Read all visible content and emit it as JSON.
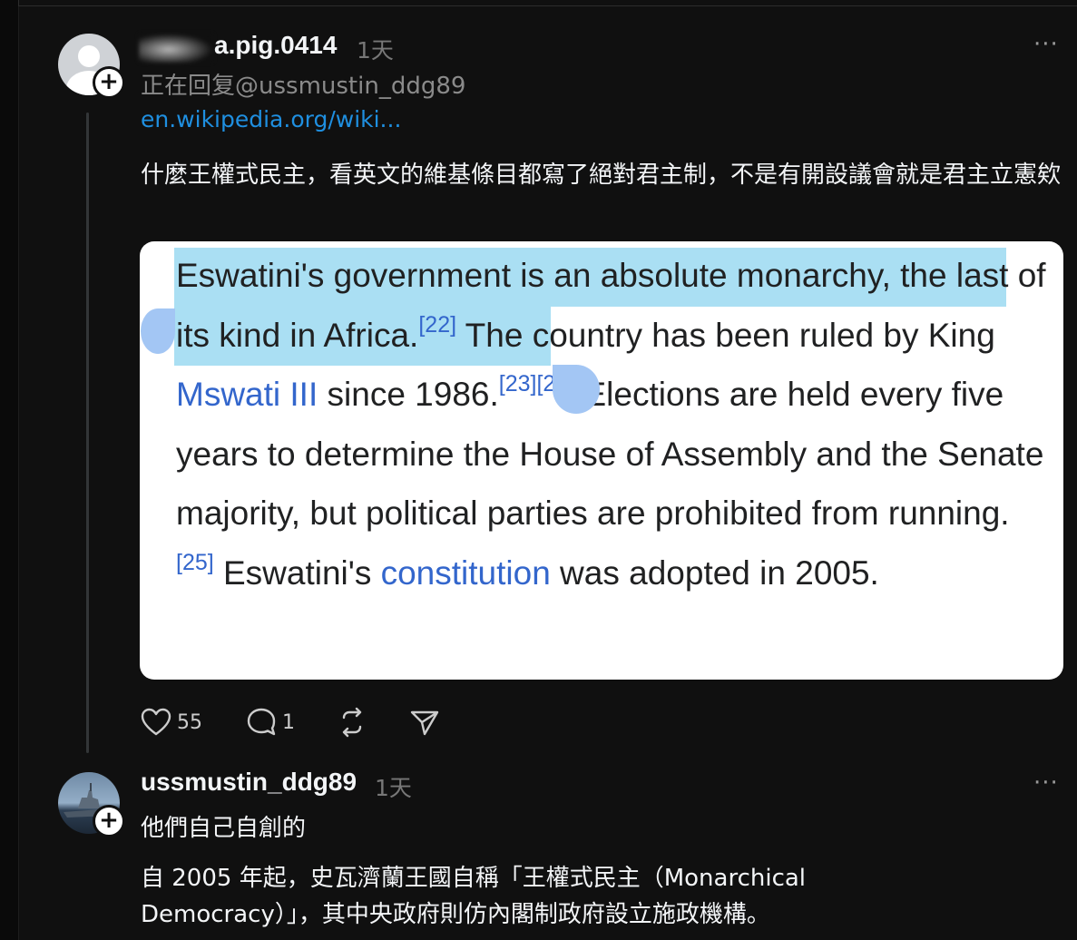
{
  "post": {
    "username": "a.pig.0414",
    "time": "1天",
    "replying_to": "正在回复@ussmustin_ddg89",
    "link": "en.wikipedia.org/wiki...",
    "text": "什麼王權式民主，看英文的維基條目都寫了絕對君主制，不是有開設議會就是君主立憲欸",
    "screenshot": {
      "s1": "Eswatini's government is an absolute monarchy, the last of its kind in Africa.",
      "ref22": "[22]",
      "s2": " The country has been ruled by King ",
      "mswati": "Mswati III",
      "s3": " since 1986.",
      "ref2324": "[23][24]",
      "s4": " Elections are held every five years to determine the House of Assembly and the Senate majority, but political parties are prohibited from running.",
      "ref25": "[25]",
      "s5": " Eswatini's ",
      "constitution": "constitution",
      "s6": " was adopted in 2005."
    },
    "likes": "55",
    "replies": "1"
  },
  "reply": {
    "username": "ussmustin_ddg89",
    "time": "1天",
    "text": "他們自己自創的",
    "body": "自 2005 年起，史瓦濟蘭王國自稱「王權式民主（Monarchical Democracy）」，其中央政府則仿內閣制政府設立施政機構。"
  },
  "more_glyph": "···",
  "plus_glyph": "+"
}
